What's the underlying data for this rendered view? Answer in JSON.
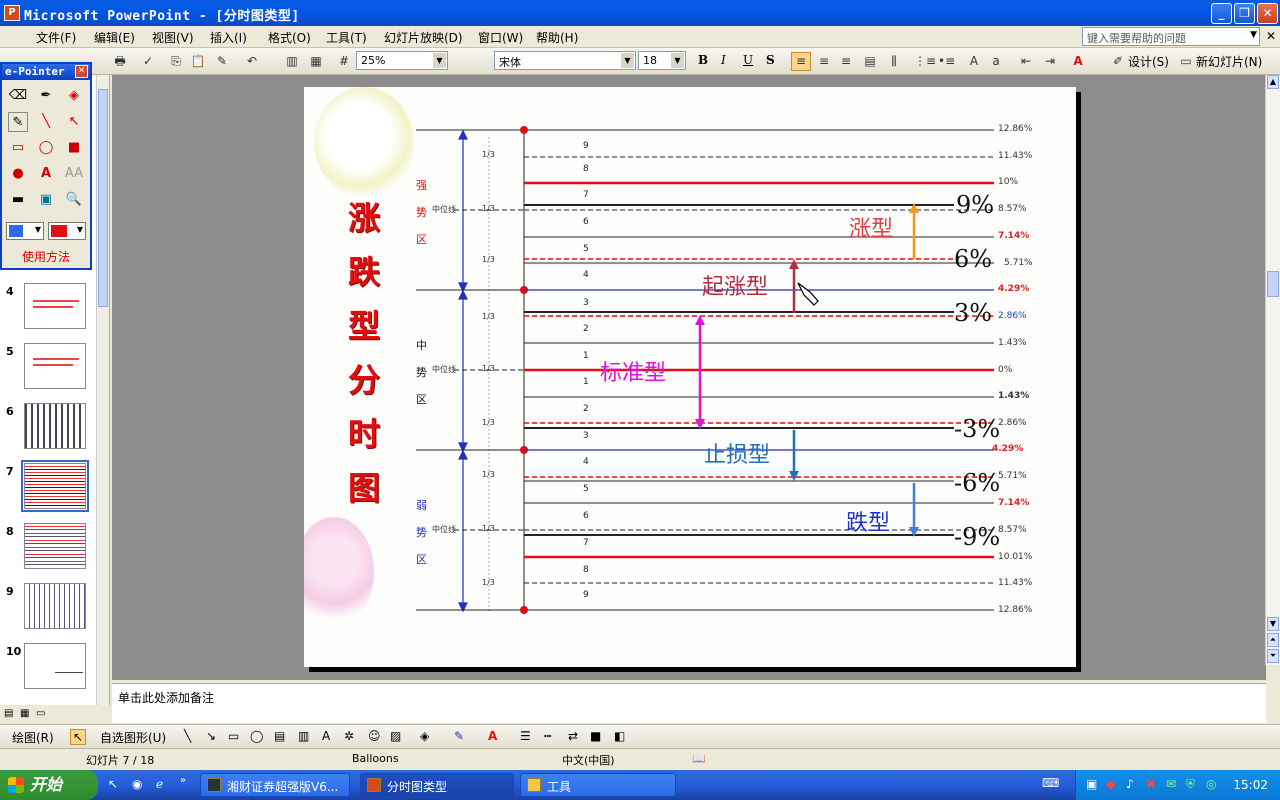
{
  "window": {
    "title": "Microsoft PowerPoint - [分时图类型]",
    "icon": "powerpoint-icon",
    "controls": [
      "minimize",
      "restore",
      "close"
    ]
  },
  "menu": {
    "items": [
      "文件(F)",
      "编辑(E)",
      "视图(V)",
      "插入(I)",
      "格式(O)",
      "工具(T)",
      "幻灯片放映(D)",
      "窗口(W)",
      "帮助(H)"
    ],
    "help_placeholder": "键入需要帮助的问题"
  },
  "toolbar": {
    "zoom": "25%",
    "font_name": "宋体",
    "font_size": "18",
    "bold": "B",
    "italic": "I",
    "underline": "U",
    "shadow": "S",
    "design_label": "设计(S)",
    "new_slide_label": "新幻灯片(N)"
  },
  "epointer": {
    "title": "e-Pointer",
    "how_to_use": "使用方法"
  },
  "thumbnails": {
    "items": [
      {
        "num": "4"
      },
      {
        "num": "5"
      },
      {
        "num": "6"
      },
      {
        "num": "7",
        "active": true
      },
      {
        "num": "8"
      },
      {
        "num": "9"
      },
      {
        "num": "10"
      }
    ]
  },
  "slide": {
    "vertical_title": [
      "涨",
      "跌",
      "型",
      "分",
      "时",
      "图"
    ],
    "zones": {
      "strong": [
        "强",
        "势",
        "区"
      ],
      "middle": [
        "中",
        "势",
        "区"
      ],
      "weak": [
        "弱",
        "势",
        "区"
      ]
    },
    "midline_label": "中位线",
    "third_label": "1/3",
    "level_numbers": [
      "9",
      "8",
      "7",
      "6",
      "5",
      "4",
      "3",
      "2",
      "1",
      "1",
      "2",
      "3",
      "4",
      "5",
      "6",
      "7",
      "8",
      "9"
    ],
    "percent_labels": [
      "12.86%",
      "11.43%",
      "10%",
      "8.57%",
      "7.14%",
      "5.71%",
      "4.29%",
      "2.86%",
      "1.43%",
      "0%",
      "1.43%",
      "2.86%",
      "4.29%",
      "5.71%",
      "7.14%",
      "8.57%",
      "10.01%",
      "11.43%",
      "12.86%"
    ],
    "big_percents": {
      "up9": "9%",
      "up6": "6%",
      "up3": "3%",
      "down3": "-3%",
      "down6": "-6%",
      "down9": "-9%"
    },
    "types": {
      "rise": "涨型",
      "start_rise": "起涨型",
      "standard": "标准型",
      "stop_loss": "止损型",
      "fall": "跌型"
    },
    "colors": {
      "red": "#e01010",
      "blue": "#1a34c8",
      "magenta": "#e010e0",
      "orange": "#f39a1a",
      "dark_red": "#b03040",
      "steel_blue": "#2070c0"
    }
  },
  "notes": {
    "placeholder": "单击此处添加备注"
  },
  "drawing_toolbar": {
    "draw_label": "绘图(R)",
    "autoshapes_label": "自选图形(U)"
  },
  "status": {
    "slide_info": "幻灯片 7 / 18",
    "template": "Balloons",
    "language": "中文(中国)"
  },
  "taskbar": {
    "start": "开始",
    "items": [
      "湘财证券超强版V6...",
      "分时图类型",
      "工具"
    ],
    "clock": "15:02"
  }
}
